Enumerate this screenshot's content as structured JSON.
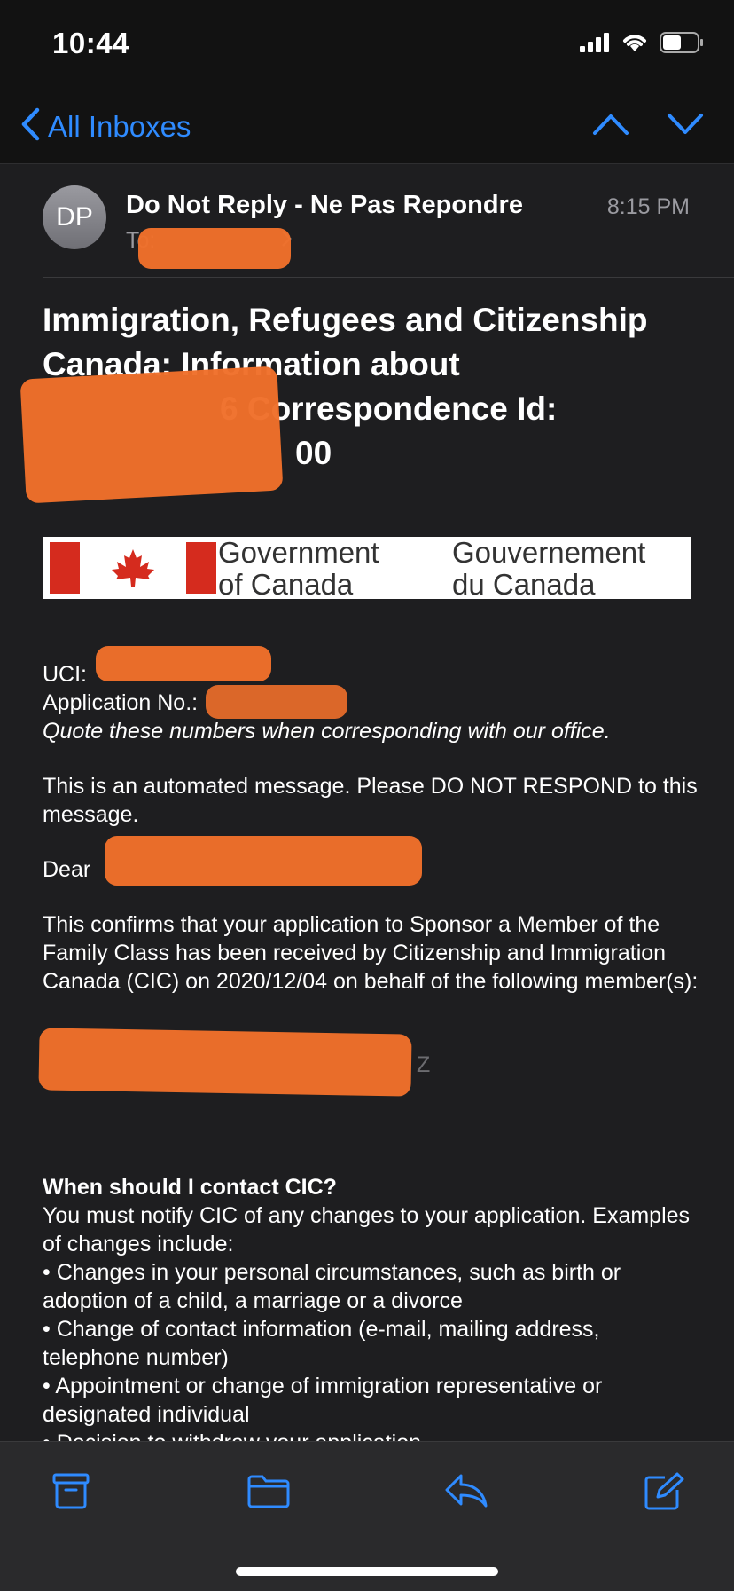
{
  "status_bar": {
    "time": "10:44"
  },
  "nav": {
    "back_label": "All Inboxes"
  },
  "header": {
    "avatar_initials": "DP",
    "sender": "Do Not Reply - Ne Pas Repondre",
    "time": "8:15 PM",
    "to_prefix": "To:"
  },
  "subject": {
    "line1": "Immigration, Refugees and Citizenship",
    "line2": "Canada: Information about",
    "line3_suffix": "6 Correspondence Id:",
    "line4_suffix": "00"
  },
  "banner": {
    "en_line1": "Government",
    "en_line2": "of Canada",
    "fr_line1": "Gouvernement",
    "fr_line2": "du Canada"
  },
  "body": {
    "uci_label": "UCI:",
    "app_label": "Application No.:",
    "quote_note": "Quote these numbers when corresponding with our office.",
    "automated": "This is an automated message.  Please DO NOT RESPOND to this message.",
    "dear": "Dear",
    "confirm": "This confirms that your application to Sponsor a Member of the Family Class has been received by Citizenship and Immigration Canada (CIC) on 2020/12/04 on behalf of the following member(s):",
    "member_tail": "Z",
    "contact_heading": "When should I contact CIC?",
    "contact_intro": "You must notify CIC of any changes to your application. Examples of changes include:",
    "bullet1": "• Changes in your personal circumstances, such as birth or adoption of a child, a marriage or a divorce",
    "bullet2": "• Change of contact information (e-mail, mailing address, telephone number)",
    "bullet3": "• Appointment or change of immigration representative or designated individual",
    "bullet4": "• Decision to withdraw your application"
  },
  "colors": {
    "accent": "#2f8bff",
    "redaction": "#f06f2a",
    "flag_red": "#d52b1e"
  },
  "icons": [
    "chevron-left-icon",
    "chevron-up-icon",
    "chevron-down-icon",
    "archive-icon",
    "folder-icon",
    "reply-icon",
    "compose-icon"
  ]
}
